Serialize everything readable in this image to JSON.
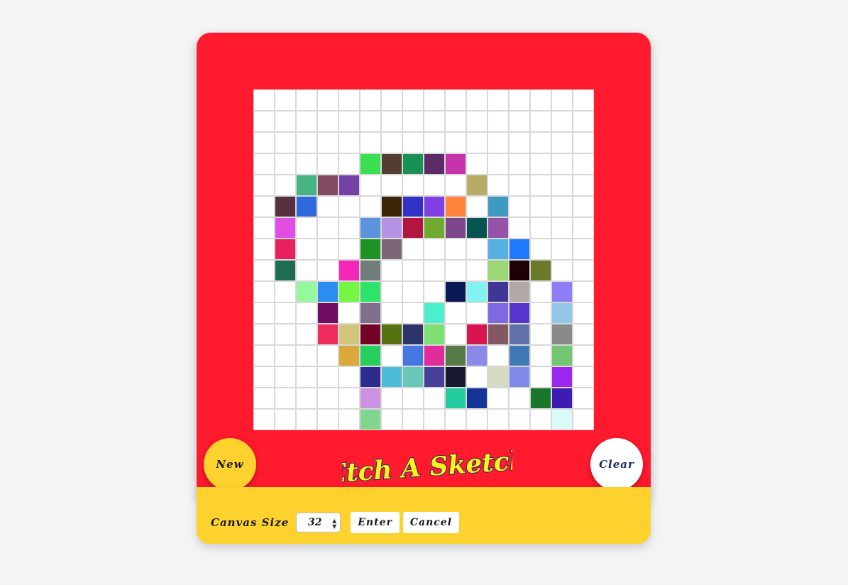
{
  "app": {
    "title": "Etch A Sketch",
    "colors": {
      "frame": "#ff1a2e",
      "tray": "#fdd22e",
      "logo_fill": "#fdf21c",
      "logo_outline": "#1c2a66"
    }
  },
  "buttons": {
    "new_label": "New",
    "clear_label": "Clear"
  },
  "controls": {
    "canvas_size_label": "Canvas Size",
    "canvas_size_value": "32",
    "enter_label": "Enter",
    "cancel_label": "Cancel"
  },
  "grid": {
    "columns": 16,
    "rows": 16,
    "painted": [
      [
        3,
        5,
        "#3be052"
      ],
      [
        3,
        6,
        "#533d31"
      ],
      [
        3,
        7,
        "#199155"
      ],
      [
        3,
        8,
        "#5d2b67"
      ],
      [
        3,
        9,
        "#c434a8"
      ],
      [
        4,
        2,
        "#46b583"
      ],
      [
        4,
        3,
        "#844a62"
      ],
      [
        4,
        4,
        "#7441a6"
      ],
      [
        4,
        10,
        "#b5ad67"
      ],
      [
        5,
        1,
        "#56303e"
      ],
      [
        5,
        2,
        "#2f69db"
      ],
      [
        5,
        6,
        "#3c2507"
      ],
      [
        5,
        7,
        "#3232c6"
      ],
      [
        5,
        8,
        "#803fe3"
      ],
      [
        5,
        9,
        "#fe843e"
      ],
      [
        5,
        11,
        "#3f9ac1"
      ],
      [
        6,
        1,
        "#e24ee4"
      ],
      [
        6,
        5,
        "#5b94dd"
      ],
      [
        6,
        6,
        "#b592e6"
      ],
      [
        6,
        7,
        "#b21640"
      ],
      [
        6,
        8,
        "#6eab30"
      ],
      [
        6,
        9,
        "#7e468b"
      ],
      [
        6,
        10,
        "#065550"
      ],
      [
        6,
        11,
        "#9552a7"
      ],
      [
        7,
        1,
        "#e8215e"
      ],
      [
        7,
        5,
        "#1d9325"
      ],
      [
        7,
        6,
        "#7b6778"
      ],
      [
        7,
        11,
        "#56b0e2"
      ],
      [
        7,
        12,
        "#1f79fa"
      ],
      [
        8,
        1,
        "#1d6e50"
      ],
      [
        8,
        4,
        "#f426b8"
      ],
      [
        8,
        5,
        "#6f7e7a"
      ],
      [
        8,
        11,
        "#9bd774"
      ],
      [
        8,
        12,
        "#1d0105"
      ],
      [
        8,
        13,
        "#6a7a28"
      ],
      [
        9,
        2,
        "#94f89c"
      ],
      [
        9,
        3,
        "#2b8df2"
      ],
      [
        9,
        4,
        "#74f642"
      ],
      [
        9,
        5,
        "#2ce46a"
      ],
      [
        9,
        9,
        "#0b1a56"
      ],
      [
        9,
        10,
        "#84f2f0"
      ],
      [
        9,
        11,
        "#413595"
      ],
      [
        9,
        12,
        "#afa8a4"
      ],
      [
        9,
        14,
        "#8d7cf3"
      ],
      [
        10,
        3,
        "#700b61"
      ],
      [
        10,
        5,
        "#806f8a"
      ],
      [
        10,
        8,
        "#4cefcb"
      ],
      [
        10,
        11,
        "#8068e0"
      ],
      [
        10,
        12,
        "#5535cc"
      ],
      [
        10,
        14,
        "#92c8e6"
      ],
      [
        11,
        3,
        "#ee2c5e"
      ],
      [
        11,
        4,
        "#d3c67a"
      ],
      [
        11,
        5,
        "#730327"
      ],
      [
        11,
        6,
        "#567313"
      ],
      [
        11,
        7,
        "#2e3468"
      ],
      [
        11,
        8,
        "#7edf73"
      ],
      [
        11,
        10,
        "#d81551"
      ],
      [
        11,
        11,
        "#815863"
      ],
      [
        11,
        12,
        "#6270a8"
      ],
      [
        11,
        14,
        "#898b88"
      ],
      [
        12,
        4,
        "#d9a93b"
      ],
      [
        12,
        5,
        "#27cd5d"
      ],
      [
        12,
        7,
        "#4377e2"
      ],
      [
        12,
        8,
        "#e02d9b"
      ],
      [
        12,
        9,
        "#567a45"
      ],
      [
        12,
        10,
        "#8b89e8"
      ],
      [
        12,
        12,
        "#3f78b2"
      ],
      [
        12,
        14,
        "#73c56f"
      ],
      [
        13,
        5,
        "#2d2b90"
      ],
      [
        13,
        6,
        "#4cbcd9"
      ],
      [
        13,
        7,
        "#67c8b8"
      ],
      [
        13,
        8,
        "#483f98"
      ],
      [
        13,
        9,
        "#181a2f"
      ],
      [
        13,
        11,
        "#d5dbc0"
      ],
      [
        13,
        12,
        "#7f89e8"
      ],
      [
        13,
        14,
        "#9b27f0"
      ],
      [
        14,
        5,
        "#cd91e3"
      ],
      [
        14,
        9,
        "#22cc9e"
      ],
      [
        14,
        10,
        "#133595"
      ],
      [
        14,
        13,
        "#19752a"
      ],
      [
        14,
        14,
        "#3e1cb3"
      ],
      [
        15,
        5,
        "#81d58f"
      ],
      [
        15,
        14,
        "#dafaf7"
      ]
    ]
  }
}
